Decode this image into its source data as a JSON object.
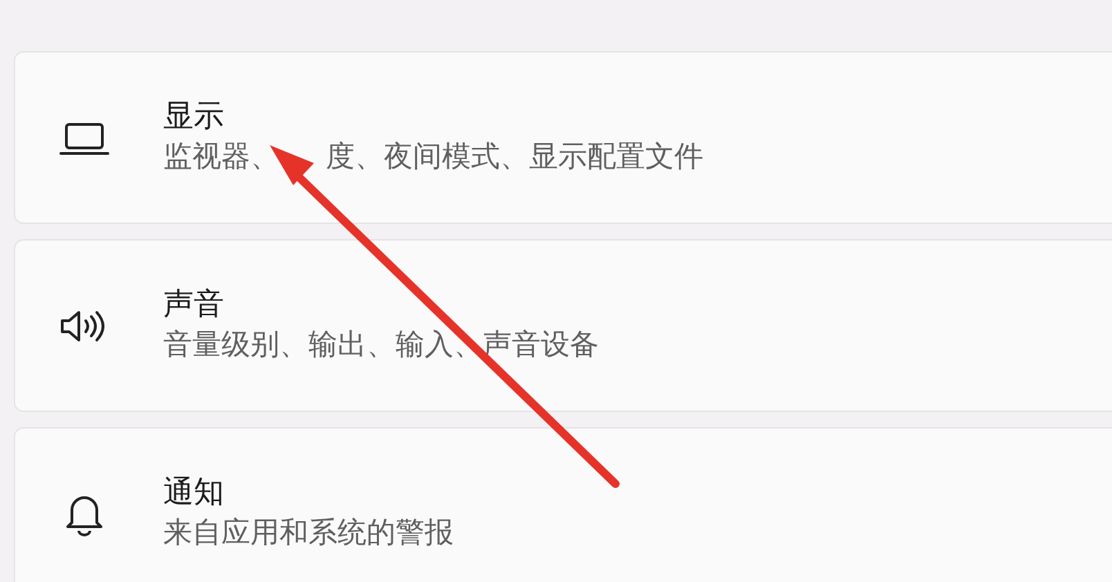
{
  "settings": [
    {
      "title": "显示",
      "subtitle_parts": [
        "监视器、",
        "度、夜间模式、显示配置文件"
      ]
    },
    {
      "title": "声音",
      "subtitle_parts": [
        "音量级别、输出、输入、声音设备"
      ]
    },
    {
      "title": "通知",
      "subtitle_parts": [
        "来自应用和系统的警报"
      ]
    }
  ]
}
